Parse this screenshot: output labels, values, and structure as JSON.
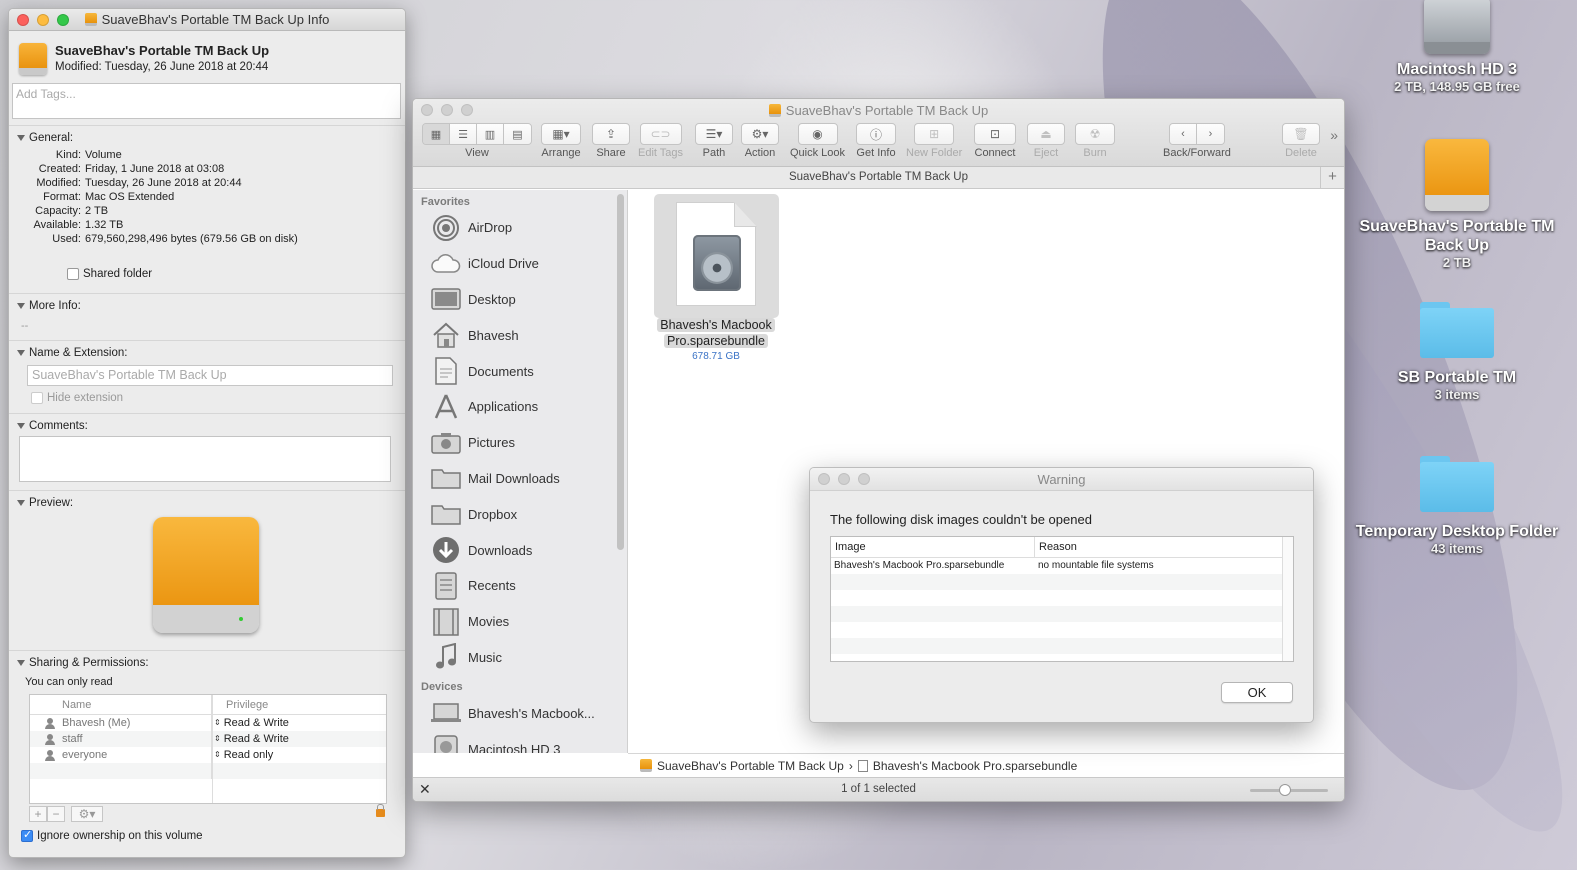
{
  "info_window": {
    "title": "SuaveBhav's Portable TM Back Up Info",
    "name": "SuaveBhav's Portable TM Back Up",
    "modified_line": "Modified: Tuesday, 26 June 2018 at 20:44",
    "tags_placeholder": "Add Tags...",
    "general": {
      "header": "General:",
      "rows": [
        {
          "k": "Kind:",
          "v": "Volume"
        },
        {
          "k": "Created:",
          "v": "Friday, 1 June 2018 at 03:08"
        },
        {
          "k": "Modified:",
          "v": "Tuesday, 26 June 2018 at 20:44"
        },
        {
          "k": "Format:",
          "v": "Mac OS Extended"
        },
        {
          "k": "Capacity:",
          "v": "2 TB"
        },
        {
          "k": "Available:",
          "v": "1.32 TB"
        },
        {
          "k": "Used:",
          "v": "679,560,298,496 bytes (679.56 GB on disk)"
        }
      ],
      "shared_folder_label": "Shared folder"
    },
    "more_info": {
      "header": "More Info:",
      "value": "--"
    },
    "name_ext": {
      "header": "Name & Extension:",
      "placeholder": "SuaveBhav's Portable TM Back Up",
      "hide_ext_label": "Hide extension"
    },
    "comments": {
      "header": "Comments:"
    },
    "preview": {
      "header": "Preview:"
    },
    "sharing": {
      "header": "Sharing & Permissions:",
      "note": "You can only read",
      "col_name": "Name",
      "col_priv": "Privilege",
      "rows": [
        {
          "name": "Bhavesh (Me)",
          "priv": "Read & Write"
        },
        {
          "name": "staff",
          "priv": "Read & Write"
        },
        {
          "name": "everyone",
          "priv": "Read only"
        }
      ],
      "ignore_label": "Ignore ownership on this volume"
    }
  },
  "finder": {
    "title": "SuaveBhav's Portable TM Back Up",
    "toolbar": {
      "view": "View",
      "arrange": "Arrange",
      "share": "Share",
      "edit_tags": "Edit Tags",
      "path": "Path",
      "action": "Action",
      "quick_look": "Quick Look",
      "get_info": "Get Info",
      "new_folder": "New Folder",
      "connect": "Connect",
      "eject": "Eject",
      "burn": "Burn",
      "back_forward": "Back/Forward",
      "delete": "Delete"
    },
    "path_header": "SuaveBhav's Portable TM Back Up",
    "sidebar": {
      "favorites_header": "Favorites",
      "favorites": [
        "AirDrop",
        "iCloud Drive",
        "Desktop",
        "Bhavesh",
        "Documents",
        "Applications",
        "Pictures",
        "Mail Downloads",
        "Dropbox",
        "Downloads",
        "Recents",
        "Movies",
        "Music"
      ],
      "devices_header": "Devices",
      "devices": [
        "Bhavesh's Macbook...",
        "Macintosh HD 3"
      ]
    },
    "file": {
      "name_line1": "Bhavesh's Macbook",
      "name_line2": "Pro.sparsebundle",
      "size": "678.71 GB"
    },
    "pathbar": {
      "volume": "SuaveBhav's Portable TM Back Up",
      "sep": "›",
      "file": "Bhavesh's Macbook Pro.sparsebundle"
    },
    "status": "1 of 1 selected",
    "zoom_level": 0.45
  },
  "warning": {
    "title": "Warning",
    "message": "The following disk images couldn't be opened",
    "col_image": "Image",
    "col_reason": "Reason",
    "rows": [
      {
        "image": "Bhavesh's Macbook Pro.sparsebundle",
        "reason": "no mountable file systems"
      }
    ],
    "ok_label": "OK"
  },
  "desktop": [
    {
      "name": "Macintosh HD 3",
      "sub": "2 TB, 148.95 GB free"
    },
    {
      "name": "SuaveBhav's Portable TM Back Up",
      "sub": "2 TB"
    },
    {
      "name": "SB Portable TM",
      "sub": "3 items"
    },
    {
      "name": "Temporary Desktop Folder",
      "sub": "43 items"
    }
  ]
}
